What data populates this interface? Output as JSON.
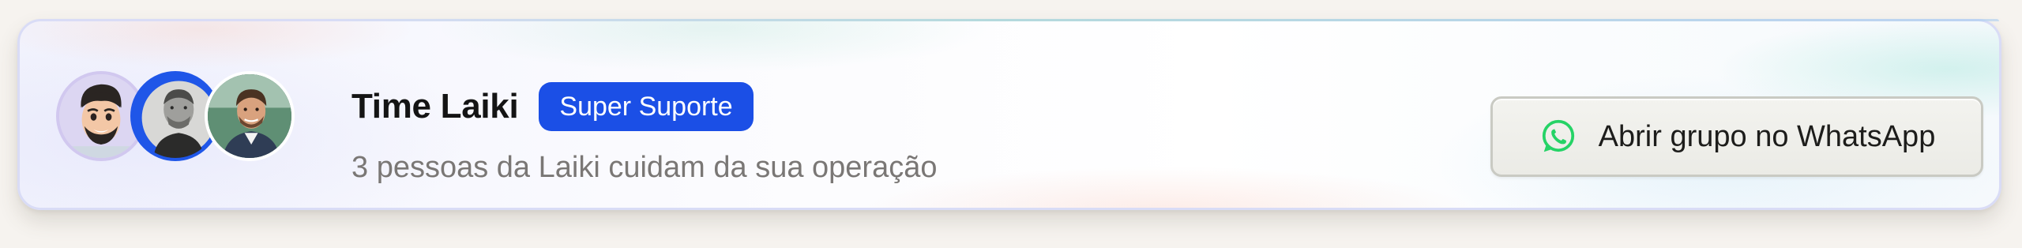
{
  "team": {
    "name": "Time Laiki",
    "badge": "Super Suporte",
    "subtitle": "3 pessoas da Laiki cuidam da sua operação"
  },
  "members": [
    {
      "kind": "memoji",
      "icon": "memoji-avatar"
    },
    {
      "kind": "photo",
      "icon": "person-photo-avatar"
    },
    {
      "kind": "photo",
      "icon": "person-photo-avatar"
    }
  ],
  "action": {
    "label": "Abrir grupo no WhatsApp",
    "icon": "whatsapp-icon"
  },
  "colors": {
    "badge": "#1b4fe6",
    "whatsapp": "#25d366",
    "subtitle": "#7a7775"
  }
}
